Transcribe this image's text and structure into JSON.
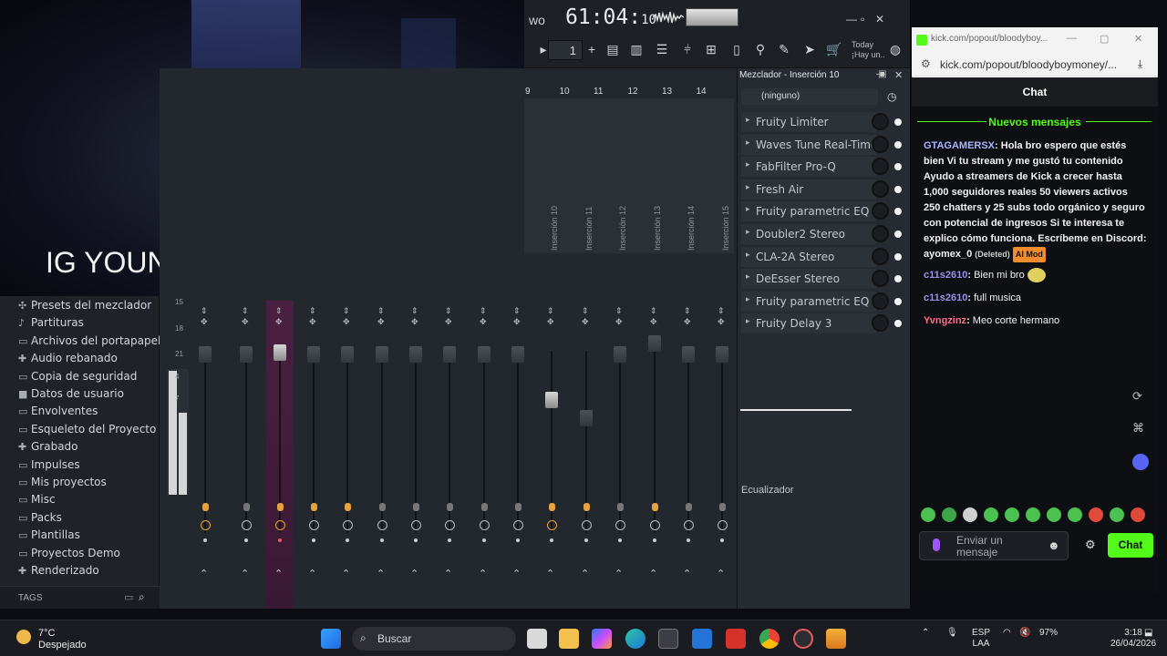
{
  "webcam": {
    "overlay_text": "IG YOUNG.BLOODY_"
  },
  "fl": {
    "time_main": "61:04:",
    "time_sub": "10",
    "pattern_number": "1",
    "today_line1": "Today",
    "today_line2": "¡Hay un..",
    "track_numbers": [
      "9",
      "10",
      "11",
      "12",
      "13",
      "14"
    ],
    "track_names": [
      "Inserción 10",
      "Inserción 11",
      "Inserción 12",
      "Inserción 13",
      "Inserción 14",
      "Inserción 15"
    ],
    "db_ticks": [
      "15",
      "18",
      "21",
      "4",
      "7"
    ]
  },
  "browser": {
    "items": [
      {
        "icon": "mixer-presets-icon",
        "label": "Presets del mezclador"
      },
      {
        "icon": "score-icon",
        "label": "Partituras"
      },
      {
        "icon": "folder-icon",
        "label": "Archivos del portapapeles"
      },
      {
        "icon": "audio-icon",
        "label": "Audio rebanado"
      },
      {
        "icon": "backup-folder-icon",
        "label": "Copia de seguridad"
      },
      {
        "icon": "user-data-icon",
        "label": "Datos de usuario"
      },
      {
        "icon": "folder-icon",
        "label": "Envolventes"
      },
      {
        "icon": "folder-icon",
        "label": "Esqueleto del Proyecto"
      },
      {
        "icon": "record-icon",
        "label": "Grabado"
      },
      {
        "icon": "folder-icon",
        "label": "Impulses"
      },
      {
        "icon": "folder-icon",
        "label": "Mis proyectos"
      },
      {
        "icon": "folder-icon",
        "label": "Misc"
      },
      {
        "icon": "folder-icon",
        "label": "Packs"
      },
      {
        "icon": "folder-icon",
        "label": "Plantillas"
      },
      {
        "icon": "folder-icon",
        "label": "Proyectos Demo"
      },
      {
        "icon": "render-icon",
        "label": "Renderizado"
      }
    ],
    "tags_label": "TAGS"
  },
  "insert_panel": {
    "title": "Mezclador - Inserción 10",
    "preset": "(ninguno)",
    "slots": [
      "Fruity Limiter",
      "Waves Tune Real-Time S..",
      "FabFilter Pro-Q",
      "Fresh Air",
      "Fruity parametric EQ 2",
      "Doubler2 Stereo",
      "CLA-2A Stereo",
      "DeEsser Stereo",
      "Fruity parametric EQ 2",
      "Fruity Delay 3"
    ],
    "eq_label": "Ecualizador"
  },
  "chat": {
    "window_title": "kick.com/popout/bloodyboy...",
    "url": "kick.com/popout/bloodyboymoney/...",
    "header": "Chat",
    "new_messages": "Nuevos mensajes",
    "messages": [
      {
        "user": "GTAGAMERSX",
        "text": "Hola bro espero que estés bien Vi tu stream y me gustó tu contenido Ayudo a streamers de Kick a crecer hasta 1,000 seguidores reales 50 viewers activos 250 chatters y 25 subs todo orgánico y seguro con potencial de ingresos Si te interesa te explico cómo funciona. Escríbeme en Discord: ayomex_0",
        "deleted": "(Deleted)",
        "badge": "AI Mod"
      },
      {
        "user": "c11s2610",
        "text": "Bien mi bro"
      },
      {
        "user": "c11s2610",
        "text": "full musica"
      },
      {
        "user": "Yvngzinz",
        "text": "Meo corte hermano"
      }
    ],
    "input_placeholder": "Enviar un mensaje",
    "send_label": "Chat",
    "accent": "#53fc18"
  },
  "taskbar": {
    "temperature": "7°C",
    "weather": "Despejado",
    "search": "Buscar",
    "lang1": "ESP",
    "lang2": "LAA",
    "battery": "97%",
    "time": "3:18",
    "date": "26/04/2026"
  }
}
